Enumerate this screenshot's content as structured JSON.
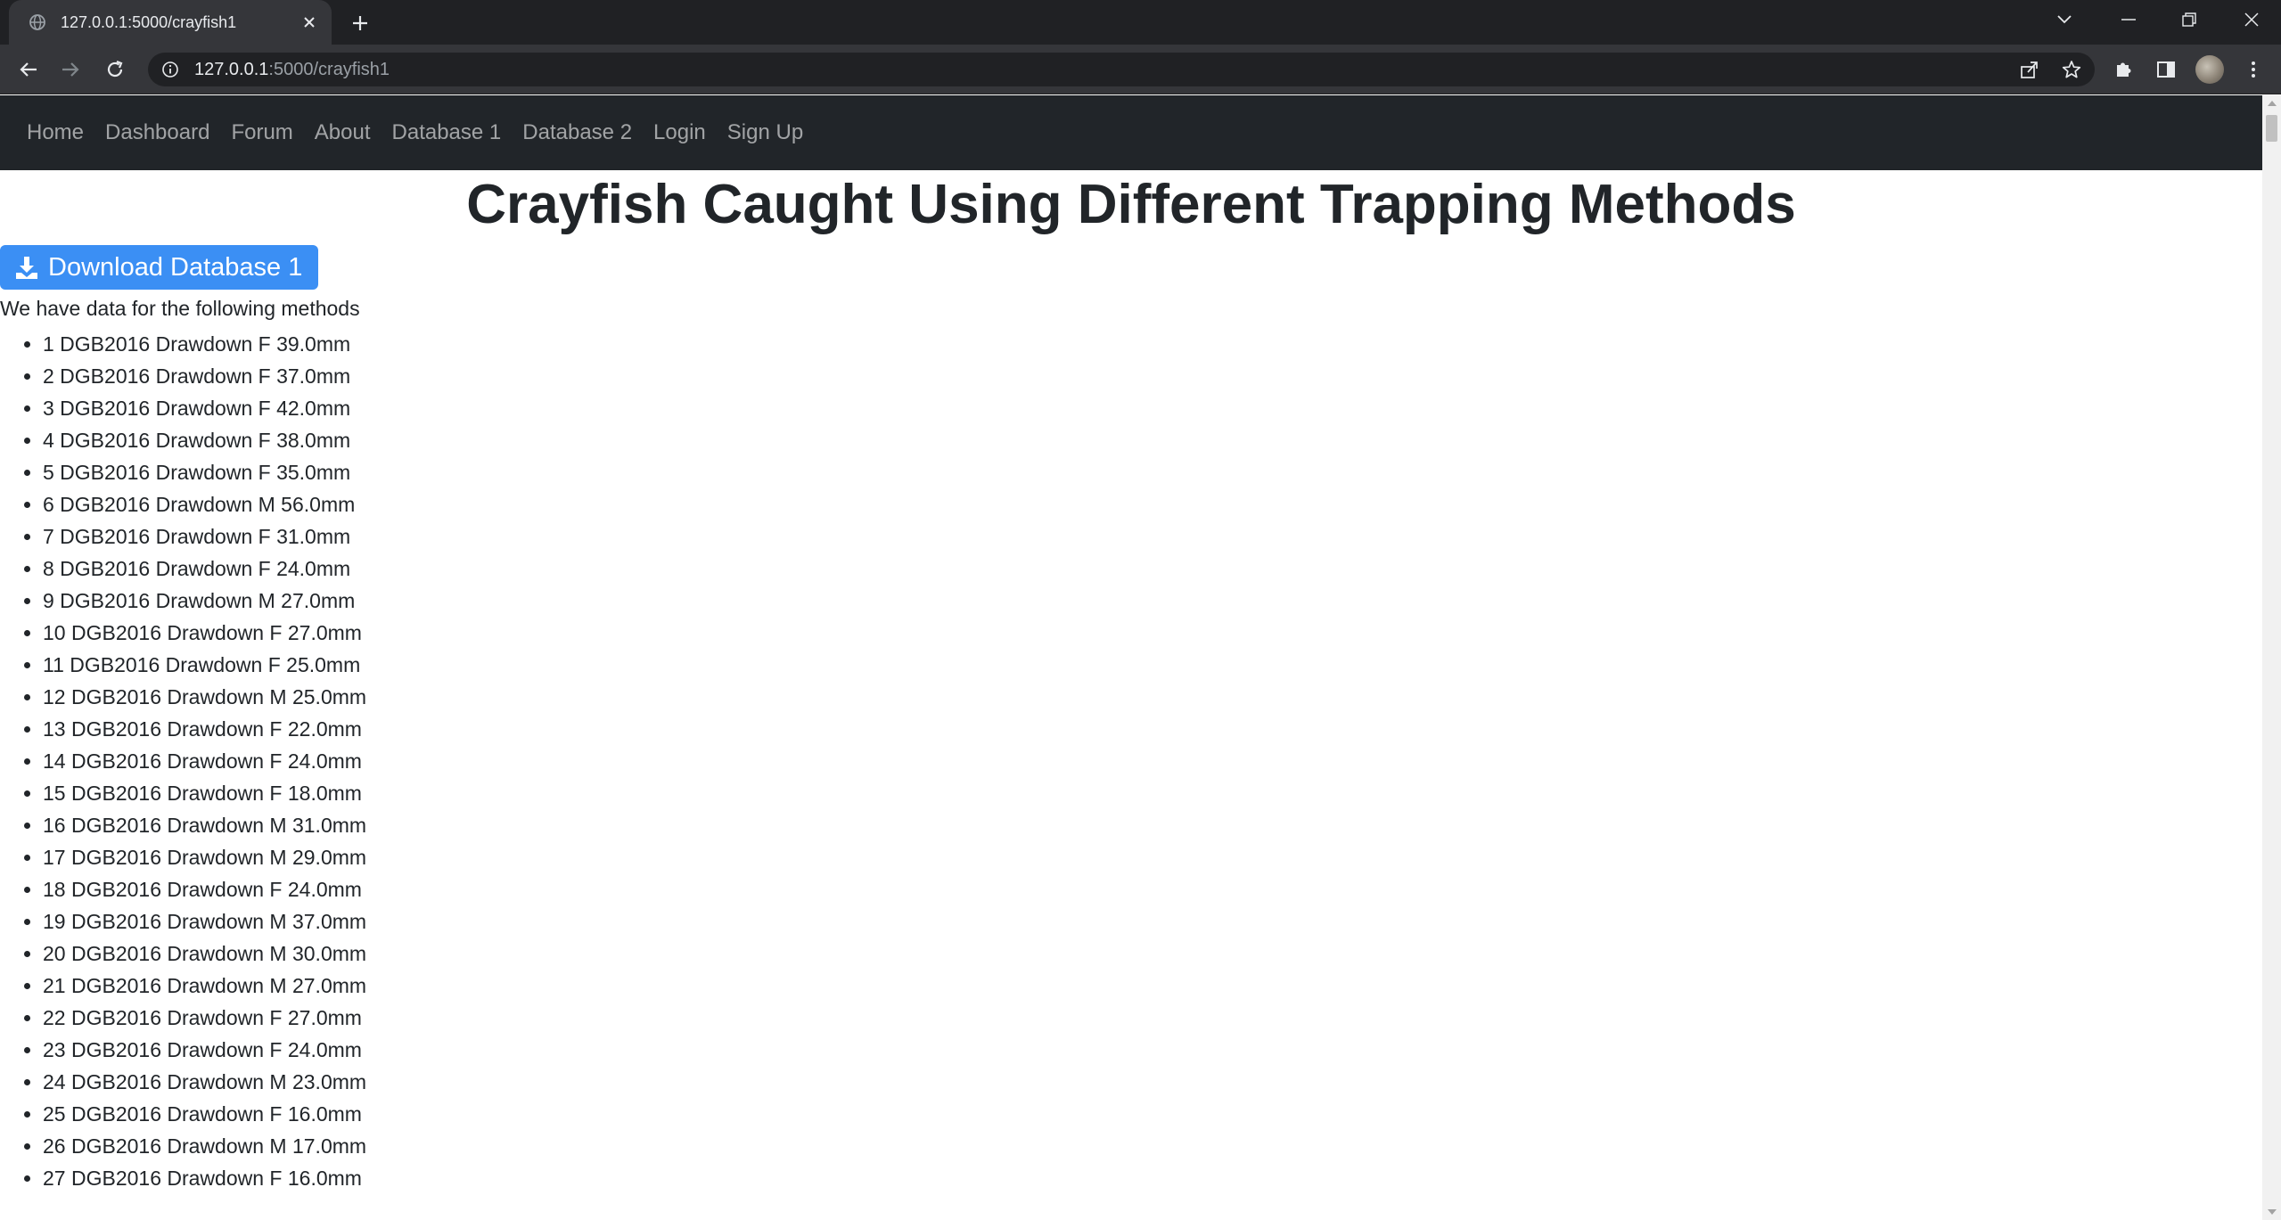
{
  "browser": {
    "tab_title": "127.0.0.1:5000/crayfish1",
    "url_host": "127.0.0.1",
    "url_path": ":5000/crayfish1",
    "icons": [
      "globe-icon",
      "close-icon",
      "plus-icon",
      "tab-search-icon",
      "minimize-icon",
      "restore-icon",
      "window-close-icon",
      "back-arrow-icon",
      "forward-arrow-icon",
      "reload-icon",
      "info-icon",
      "share-icon",
      "star-icon",
      "puzzle-icon",
      "side-panel-icon",
      "kebab-menu-icon"
    ]
  },
  "nav": {
    "items": [
      "Home",
      "Dashboard",
      "Forum",
      "About",
      "Database 1",
      "Database 2",
      "Login",
      "Sign Up"
    ]
  },
  "page": {
    "title": "Crayfish Caught Using Different Trapping Methods",
    "download_label": "Download Database 1",
    "intro": "We have data for the following methods",
    "methods": [
      "1 DGB2016 Drawdown F 39.0mm",
      "2 DGB2016 Drawdown F 37.0mm",
      "3 DGB2016 Drawdown F 42.0mm",
      "4 DGB2016 Drawdown F 38.0mm",
      "5 DGB2016 Drawdown F 35.0mm",
      "6 DGB2016 Drawdown M 56.0mm",
      "7 DGB2016 Drawdown F 31.0mm",
      "8 DGB2016 Drawdown F 24.0mm",
      "9 DGB2016 Drawdown M 27.0mm",
      "10 DGB2016 Drawdown F 27.0mm",
      "11 DGB2016 Drawdown F 25.0mm",
      "12 DGB2016 Drawdown M 25.0mm",
      "13 DGB2016 Drawdown F 22.0mm",
      "14 DGB2016 Drawdown F 24.0mm",
      "15 DGB2016 Drawdown F 18.0mm",
      "16 DGB2016 Drawdown M 31.0mm",
      "17 DGB2016 Drawdown M 29.0mm",
      "18 DGB2016 Drawdown F 24.0mm",
      "19 DGB2016 Drawdown M 37.0mm",
      "20 DGB2016 Drawdown M 30.0mm",
      "21 DGB2016 Drawdown M 27.0mm",
      "22 DGB2016 Drawdown F 27.0mm",
      "23 DGB2016 Drawdown F 24.0mm",
      "24 DGB2016 Drawdown M 23.0mm",
      "25 DGB2016 Drawdown F 16.0mm",
      "26 DGB2016 Drawdown M 17.0mm",
      "27 DGB2016 Drawdown F 16.0mm"
    ]
  },
  "colors": {
    "navbar_bg": "#212529",
    "button_bg": "#3b8ff4",
    "chrome_dark": "#202124",
    "chrome_toolbar": "#35363a"
  }
}
